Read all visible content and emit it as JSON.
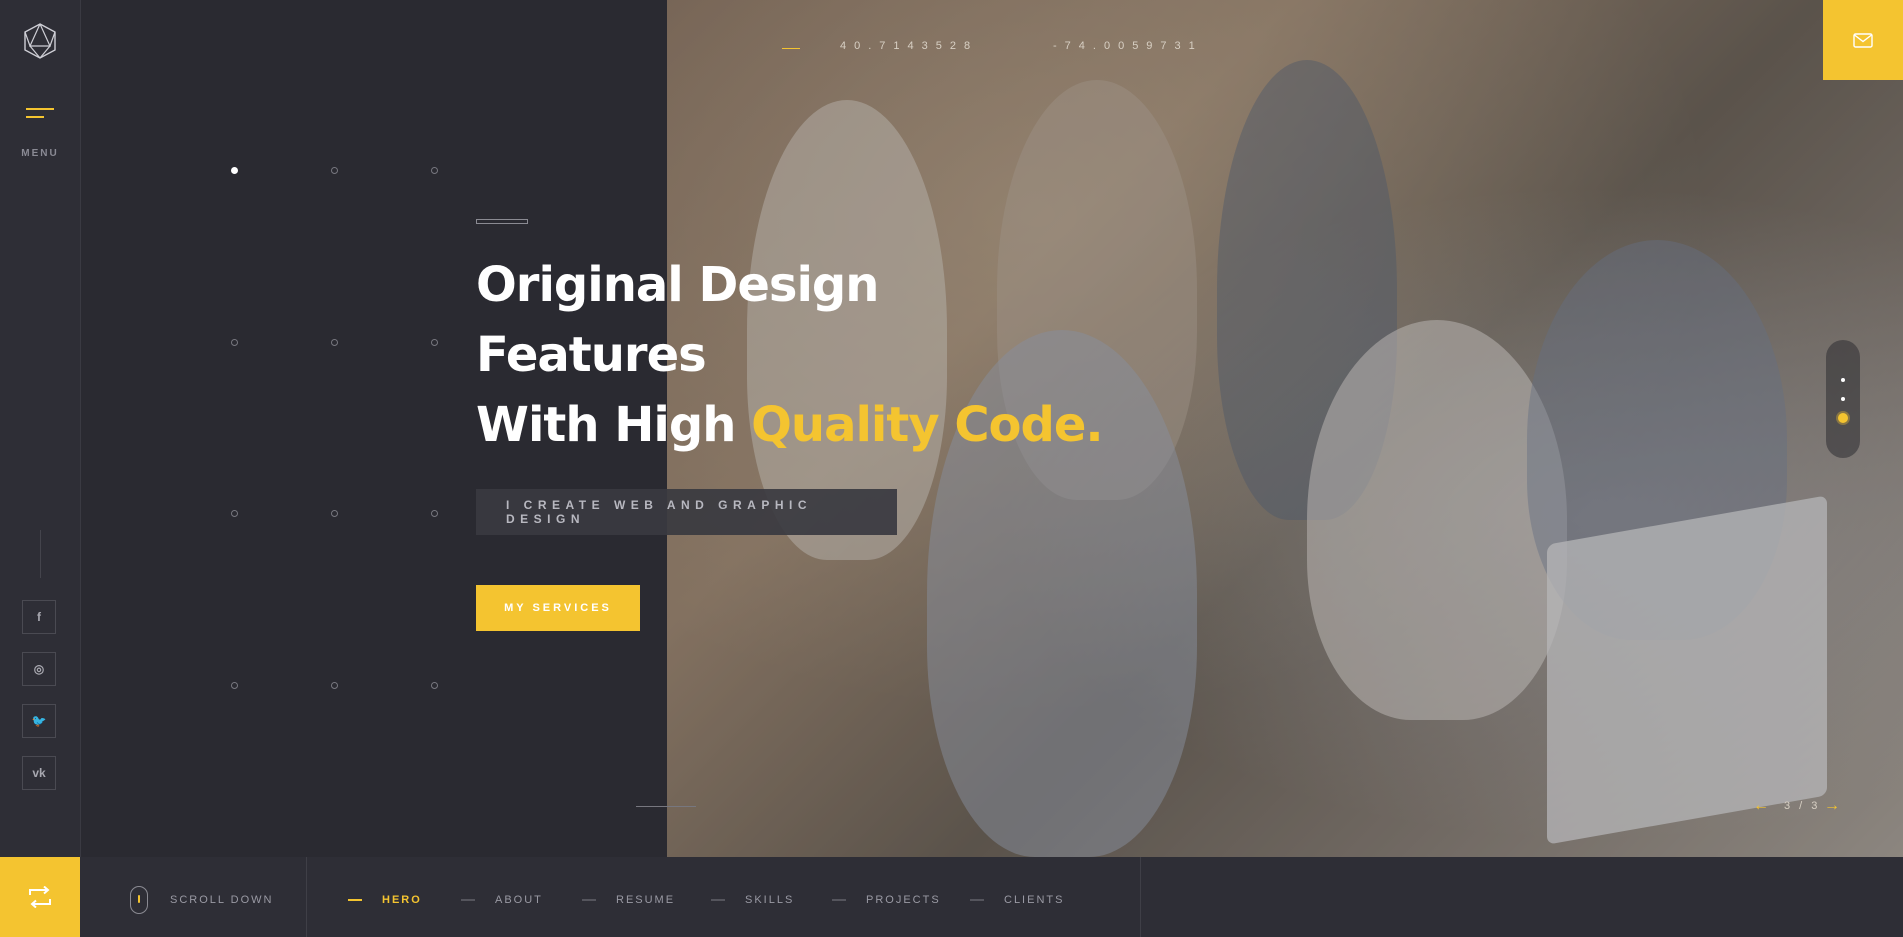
{
  "brand": {
    "logo_icon": "geometric-polyhedron-icon"
  },
  "sidebar": {
    "menu_label": "MENU",
    "social": [
      {
        "name": "facebook",
        "glyph": "f"
      },
      {
        "name": "instagram",
        "glyph": "◎"
      },
      {
        "name": "twitter",
        "glyph": "🐦"
      },
      {
        "name": "vk",
        "glyph": "vk"
      }
    ]
  },
  "coordinates": {
    "lat": "40.7143528",
    "lng": "-74.0059731"
  },
  "hero": {
    "title_line1": "Original Design",
    "title_line2": "Features",
    "title_line3_plain": "With High ",
    "title_line3_accent": "Quality Code.",
    "subtitle": "I CREATE WEB AND GRAPHIC DESIGN",
    "cta_label": "MY SERVICES"
  },
  "slider": {
    "current": 3,
    "total": 3,
    "counter": "3 / 3"
  },
  "bottom": {
    "scroll_label": "SCROLL DOWN",
    "nav": [
      {
        "label": "HERO",
        "active": true
      },
      {
        "label": "ABOUT",
        "active": false
      },
      {
        "label": "RESUME",
        "active": false
      },
      {
        "label": "SKILLS",
        "active": false
      },
      {
        "label": "PROJECTS",
        "active": false
      },
      {
        "label": "CLIENTS",
        "active": false
      }
    ]
  },
  "colors": {
    "accent": "#f4c430",
    "background": "#2a2a31",
    "sidebar": "#2e2e36"
  }
}
